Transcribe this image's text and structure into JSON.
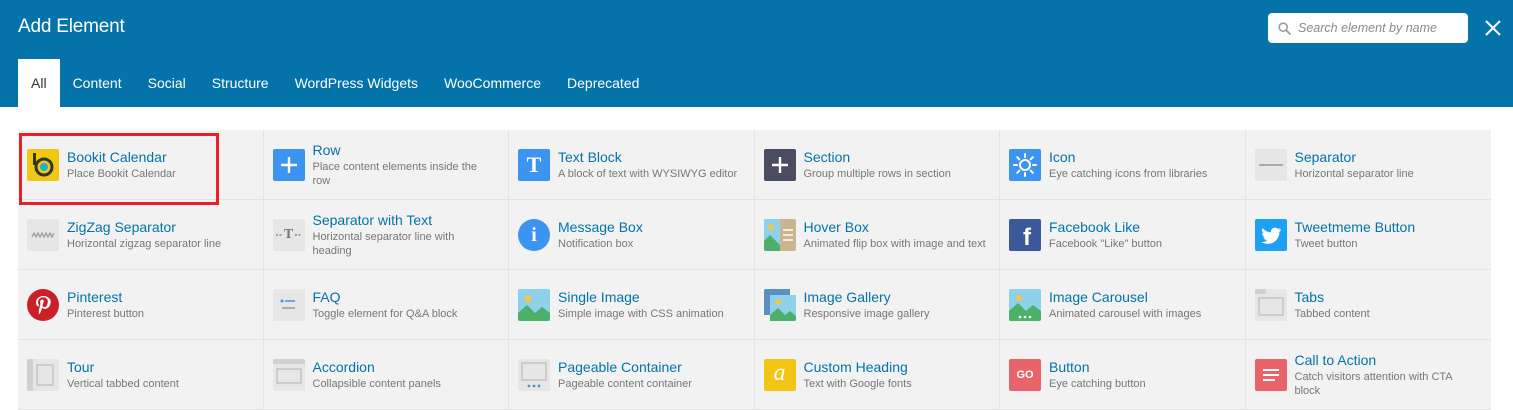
{
  "header": {
    "title": "Add Element",
    "search_placeholder": "Search element by name"
  },
  "tabs": [
    {
      "label": "All",
      "active": true
    },
    {
      "label": "Content"
    },
    {
      "label": "Social"
    },
    {
      "label": "Structure"
    },
    {
      "label": "WordPress Widgets"
    },
    {
      "label": "WooCommerce"
    },
    {
      "label": "Deprecated"
    }
  ],
  "elements": [
    {
      "name": "Bookit Calendar",
      "desc": "Place Bookit Calendar",
      "icon": "bookit-calendar-icon"
    },
    {
      "name": "Row",
      "desc": "Place content elements inside the row",
      "icon": "plus-icon"
    },
    {
      "name": "Text Block",
      "desc": "A block of text with WYSIWYG editor",
      "icon": "text-t-icon"
    },
    {
      "name": "Section",
      "desc": "Group multiple rows in section",
      "icon": "plus-icon"
    },
    {
      "name": "Icon",
      "desc": "Eye catching icons from libraries",
      "icon": "sun-icon"
    },
    {
      "name": "Separator",
      "desc": "Horizontal separator line",
      "icon": "separator-icon"
    },
    {
      "name": "ZigZag Separator",
      "desc": "Horizontal zigzag separator line",
      "icon": "zigzag-icon"
    },
    {
      "name": "Separator with Text",
      "desc": "Horizontal separator line with heading",
      "icon": "separator-text-icon"
    },
    {
      "name": "Message Box",
      "desc": "Notification box",
      "icon": "info-icon"
    },
    {
      "name": "Hover Box",
      "desc": "Animated flip box with image and text",
      "icon": "hover-box-icon"
    },
    {
      "name": "Facebook Like",
      "desc": "Facebook \"Like\" button",
      "icon": "facebook-icon"
    },
    {
      "name": "Tweetmeme Button",
      "desc": "Tweet button",
      "icon": "twitter-icon"
    },
    {
      "name": "Pinterest",
      "desc": "Pinterest button",
      "icon": "pinterest-icon"
    },
    {
      "name": "FAQ",
      "desc": "Toggle element for Q&A block",
      "icon": "faq-icon"
    },
    {
      "name": "Single Image",
      "desc": "Simple image with CSS animation",
      "icon": "image-icon"
    },
    {
      "name": "Image Gallery",
      "desc": "Responsive image gallery",
      "icon": "gallery-icon"
    },
    {
      "name": "Image Carousel",
      "desc": "Animated carousel with images",
      "icon": "carousel-icon"
    },
    {
      "name": "Tabs",
      "desc": "Tabbed content",
      "icon": "tabs-icon"
    },
    {
      "name": "Tour",
      "desc": "Vertical tabbed content",
      "icon": "tour-icon"
    },
    {
      "name": "Accordion",
      "desc": "Collapsible content panels",
      "icon": "accordion-icon"
    },
    {
      "name": "Pageable Container",
      "desc": "Pageable content container",
      "icon": "pageable-icon"
    },
    {
      "name": "Custom Heading",
      "desc": "Text with Google fonts",
      "icon": "custom-heading-icon"
    },
    {
      "name": "Button",
      "desc": "Eye catching button",
      "icon": "go-button-icon"
    },
    {
      "name": "Call to Action",
      "desc": "Catch visitors attention with CTA block",
      "icon": "cta-icon"
    }
  ],
  "icon_glyphs": {
    "text": "T",
    "info": "i",
    "facebook": "f",
    "custom_heading": "a",
    "go": "GO",
    "separator_text": "T"
  },
  "colors": {
    "header_bg": "#0473aa",
    "link": "#0473aa",
    "highlight": "#e8202a"
  }
}
